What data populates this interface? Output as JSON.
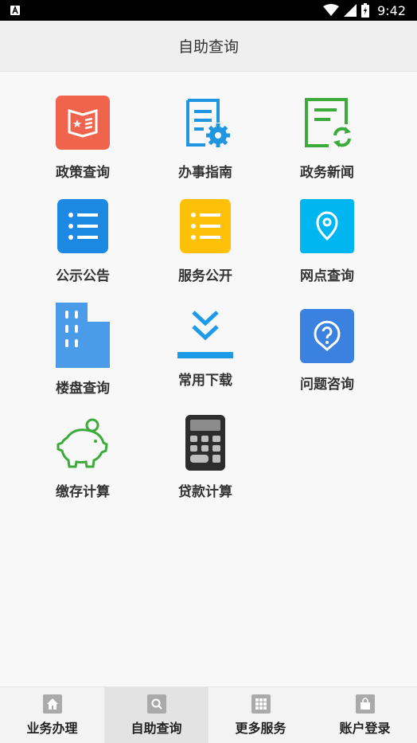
{
  "status": {
    "time": "9:42"
  },
  "header": {
    "title": "自助查询"
  },
  "tiles": [
    {
      "label": "政策查询",
      "icon": "policy-book-icon",
      "color": "#f0644e"
    },
    {
      "label": "办事指南",
      "icon": "document-gear-icon",
      "color": "#2196e0"
    },
    {
      "label": "政务新闻",
      "icon": "news-refresh-icon",
      "color": "#3cab3c"
    },
    {
      "label": "公示公告",
      "icon": "list-icon",
      "color": "#1e88e5"
    },
    {
      "label": "服务公开",
      "icon": "list-icon",
      "color": "#ffc107"
    },
    {
      "label": "网点查询",
      "icon": "location-pin-icon",
      "color": "#00b6f0"
    },
    {
      "label": "楼盘查询",
      "icon": "building-icon",
      "color": "#4a9be8"
    },
    {
      "label": "常用下载",
      "icon": "download-icon",
      "color": "#1e9be8"
    },
    {
      "label": "问题咨询",
      "icon": "question-bubble-icon",
      "color": "#3b82e0"
    },
    {
      "label": "缴存计算",
      "icon": "piggy-bank-icon",
      "color": "#3cab3c"
    },
    {
      "label": "贷款计算",
      "icon": "calculator-icon",
      "color": "#2d2d2d"
    }
  ],
  "tabs": [
    {
      "label": "业务办理",
      "icon": "home-icon"
    },
    {
      "label": "自助查询",
      "icon": "search-icon",
      "active": true
    },
    {
      "label": "更多服务",
      "icon": "grid-icon"
    },
    {
      "label": "账户登录",
      "icon": "bag-icon"
    }
  ]
}
